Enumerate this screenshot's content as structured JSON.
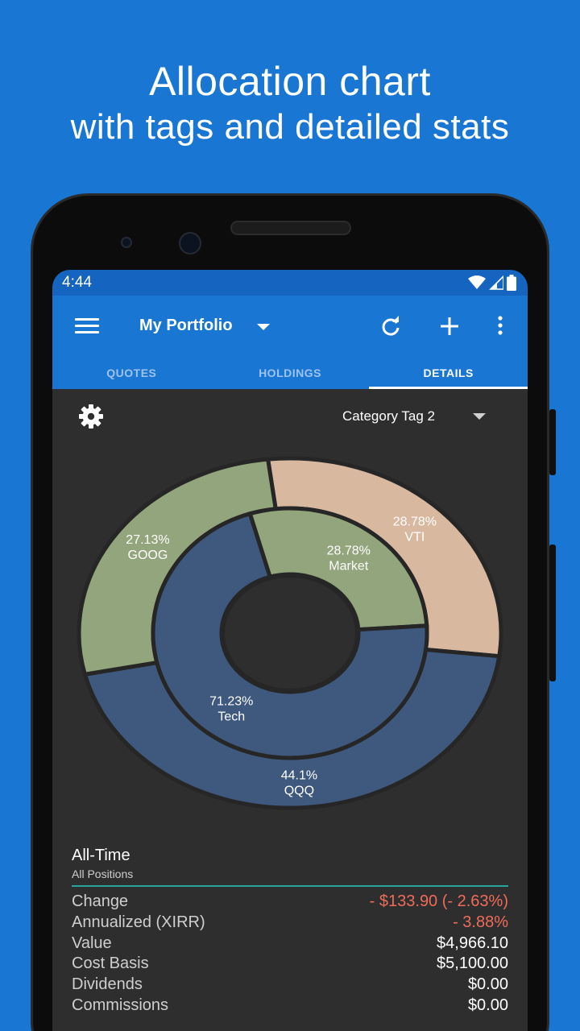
{
  "headline": {
    "line1": "Allocation chart",
    "line2": "with tags and detailed stats"
  },
  "status_bar": {
    "time": "4:44"
  },
  "app_bar": {
    "title": "My Portfolio",
    "icons": [
      "menu-icon",
      "refresh-icon",
      "add-icon",
      "more-vert-icon"
    ]
  },
  "tabs": [
    {
      "label": "QUOTES",
      "active": false
    },
    {
      "label": "HOLDINGS",
      "active": false
    },
    {
      "label": "DETAILS",
      "active": true
    }
  ],
  "filter": {
    "selected": "Category Tag 2"
  },
  "chart_data": {
    "type": "pie",
    "style": "nested-donut",
    "outer": [
      {
        "label": "VTI",
        "value_label": "28.78%",
        "value": 28.78,
        "color": "#D9B8A0"
      },
      {
        "label": "QQQ",
        "value_label": "44.1%",
        "value": 44.1,
        "color": "#3F587E"
      },
      {
        "label": "GOOG",
        "value_label": "27.13%",
        "value": 27.13,
        "color": "#93A57C"
      }
    ],
    "inner": [
      {
        "label": "Market",
        "value_label": "28.78%",
        "value": 28.78,
        "color": "#93A57C"
      },
      {
        "label": "Tech",
        "value_label": "71.23%",
        "value": 71.23,
        "color": "#3F587E"
      }
    ]
  },
  "stats": {
    "title": "All-Time",
    "subtitle": "All Positions",
    "rows": [
      {
        "label": "Change",
        "value": "- $133.90 (- 2.63%)",
        "negative": true
      },
      {
        "label": "Annualized (XIRR)",
        "value": "- 3.88%",
        "negative": true
      },
      {
        "label": "Value",
        "value": "$4,966.10",
        "negative": false
      },
      {
        "label": "Cost Basis",
        "value": "$5,100.00",
        "negative": false
      },
      {
        "label": "Dividends",
        "value": "$0.00",
        "negative": false
      },
      {
        "label": "Commissions",
        "value": "$0.00",
        "negative": false
      }
    ]
  }
}
